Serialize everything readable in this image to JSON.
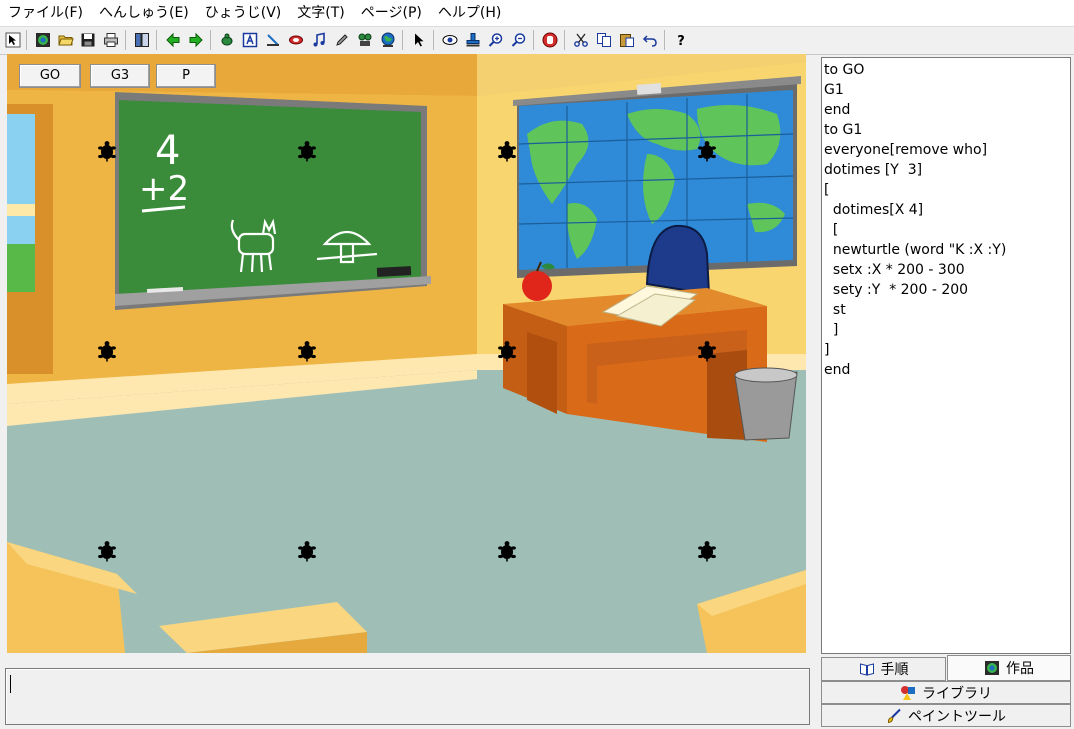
{
  "menu": [
    "ファイル(F)",
    "へんしゅう(E)",
    "ひょうじ(V)",
    "文字(T)",
    "ページ(P)",
    "ヘルプ(H)"
  ],
  "toolbar": {
    "icons": [
      "select-arrow-icon",
      "new-page-icon",
      "open-folder-icon",
      "save-disk-icon",
      "print-icon",
      "page-list-icon",
      "back-arrow-icon",
      "forward-arrow-icon",
      "new-turtle-icon",
      "text-box-icon",
      "slider-icon",
      "light-icon",
      "music-note-icon",
      "pencil-icon",
      "animation-icon",
      "globe-icon",
      "pointer-icon",
      "eye-icon",
      "stamp-icon",
      "zoom-in-icon",
      "zoom-out-icon",
      "stop-hand-icon",
      "cut-icon",
      "copy-icon",
      "paste-icon",
      "undo-icon",
      "help-icon"
    ]
  },
  "stage": {
    "buttons": [
      {
        "label": "GO"
      },
      {
        "label": "G3"
      },
      {
        "label": "P"
      }
    ],
    "chalkboard": {
      "line1": "4",
      "line2": "+2"
    },
    "turtle_count": 12
  },
  "editor": {
    "lines": [
      "to GO",
      "G1",
      "end",
      "to G1",
      "everyone[remove who]",
      "dotimes [Y  3]",
      "[",
      "  dotimes[X 4]",
      "  [",
      "  newturtle (word \"K :X :Y)",
      "  setx :X * 200 - 300",
      "  sety :Y  * 200 - 200",
      "  st",
      "  ]",
      "]",
      "end"
    ]
  },
  "tabs": {
    "procedures": "手順",
    "project": "作品",
    "library": "ライブラリ",
    "paint_tools": "ペイントツール"
  },
  "colors": {
    "wall": "#f2bf4c",
    "chalkboard": "#3a8c3a",
    "floor": "#9fbfb6",
    "desk": "#d86a18"
  }
}
